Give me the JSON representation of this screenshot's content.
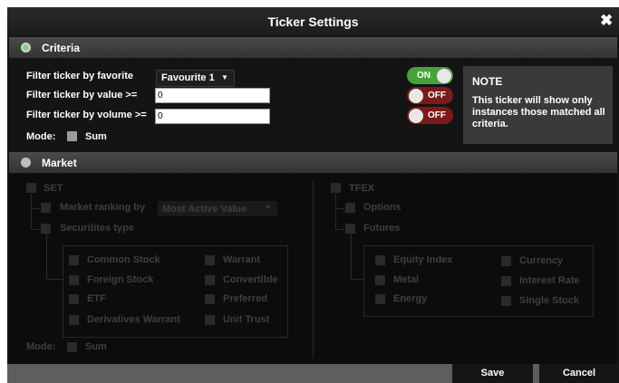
{
  "window": {
    "title": "Ticker Settings",
    "close_glyph": "✖"
  },
  "criteria": {
    "section_label": "Criteria",
    "favorite_label": "Filter ticker by favorite",
    "favorite_selected": "Favourite 1",
    "value_label": "Filter ticker by value >=",
    "value_input": "0",
    "volume_label": "Filter ticker by volume >=",
    "volume_input": "0",
    "mode_label": "Mode:",
    "mode_option": "Sum",
    "toggles": [
      {
        "label": "ON",
        "state": "on"
      },
      {
        "label": "OFF",
        "state": "off"
      },
      {
        "label": "OFF",
        "state": "off"
      }
    ],
    "note_title": "NOTE",
    "note_text": "This ticker will show only instances those matched all criteria."
  },
  "market": {
    "section_label": "Market",
    "set": {
      "label": "SET",
      "ranking_label": "Market ranking by",
      "ranking_selected": "Most Active Value",
      "securities_label": "Securitites type",
      "types_col1": [
        "Common Stock",
        "Foreign Stock",
        "ETF",
        "Derivatives Warrant"
      ],
      "types_col2": [
        "Warrant",
        "Convertible",
        "Preferred",
        "Unit Trust"
      ]
    },
    "tfex": {
      "label": "TFEX",
      "options_label": "Options",
      "futures_label": "Futures",
      "futures_col1": [
        "Equity Index",
        "Metal",
        "Energy"
      ],
      "futures_col2": [
        "Currency",
        "Interest Rate",
        "Single Stock"
      ]
    },
    "mode_label": "Mode:",
    "mode_option": "Sum"
  },
  "footer": {
    "save_label": "Save",
    "cancel_label": "Cancel"
  },
  "colors": {
    "toggle_on": "#48a23a",
    "toggle_off": "#7a1a1a",
    "note_bg": "#3a3a3a"
  }
}
